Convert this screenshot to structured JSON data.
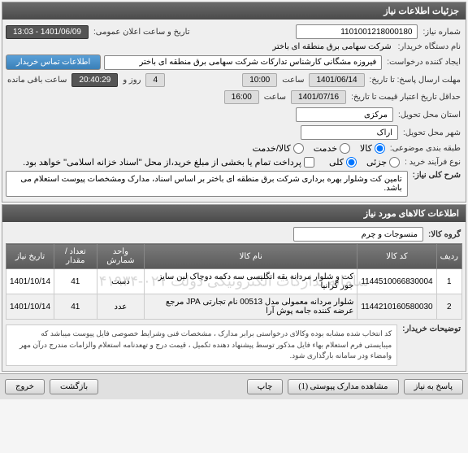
{
  "panel1": {
    "title": "جزئیات اطلاعات نیاز",
    "need_number_label": "شماره نیاز:",
    "need_number": "1101001218000180",
    "announce_label": "تاریخ و ساعت اعلان عمومی:",
    "announce_value": "1401/06/09 - 13:03",
    "buyer_label": "نام دستگاه خریدار:",
    "buyer_value": "شرکت سهامی برق منطقه ای باختر",
    "requester_label": "ایجاد کننده درخواست:",
    "requester_value": "فیروزه مشگانی کارشناس تدارکات شرکت سهامی برق منطقه ای باختر",
    "contact_btn": "اطلاعات تماس خریدار",
    "deadline_label": "مهلت ارسال پاسخ: تا تاریخ:",
    "deadline_date": "1401/06/14",
    "time_label": "ساعت",
    "deadline_time": "10:00",
    "day_label": "روز و",
    "days_value": "4",
    "countdown": "20:40:29",
    "remaining_label": "ساعت باقی مانده",
    "price_valid_label": "حداقل تاریخ اعتبار قیمت تا تاریخ:",
    "price_valid_date": "1401/07/16",
    "price_valid_time": "16:00",
    "province_label": "استان محل تحویل:",
    "province_value": "مرکزی",
    "city_label": "شهر محل تحویل:",
    "city_value": "اراک",
    "classification_label": "طبقه بندی موضوعی:",
    "radio_goods": "کالا",
    "radio_service": "خدمت",
    "radio_both": "کالا/خدمت",
    "process_label": "نوع فرآیند خرید :",
    "radio_partial": "جزئی",
    "radio_full": "کلی",
    "payment_note": "پرداخت تمام یا بخشی از مبلغ خرید،از محل \"اسناد خزانه اسلامی\" خواهد بود.",
    "overall_label": "شرح کلی نیاز:",
    "overall_text": "تامین کت وشلوار بهره برداری شرکت برق منطقه ای باختر بر اساس اسناد، مدارک ومشخصات پیوست استعلام می باشد."
  },
  "panel2": {
    "title": "اطلاعات کالاهای مورد نیاز",
    "group_label": "گروه کالا:",
    "group_value": "منسوجات و چرم",
    "watermark": "سامانه تدارکات الکترونیکی دولت ۰۲۱-۴۱۹۳۴",
    "headers": {
      "row": "ردیف",
      "code": "کد کالا",
      "name": "نام کالا",
      "unit": "واحد شمارش",
      "qty": "تعداد / مقدار",
      "date": "تاریخ نیاز"
    },
    "rows": [
      {
        "idx": "1",
        "code": "1144510066830004",
        "name": "کت و شلوار مردانه یقه انگلیسی سه دکمه دوچاک لین سایز جور گرانیا",
        "unit": "دست",
        "qty": "41",
        "date": "1401/10/14"
      },
      {
        "idx": "2",
        "code": "1144210160580030",
        "name": "شلوار مردانه معمولی مدل 00513 نام تجارتی JPA مرجع عرضه کننده جامه پوش آرا",
        "unit": "عدد",
        "qty": "41",
        "date": "1401/10/14"
      }
    ],
    "explain_label": "توضیحات خریدار:",
    "explain_text": "کد انتخاب شده مشابه بوده وکالای درخواستی برابر مدارک ، مشخصات فنی وشرایط خصوصی فایل پیوست میباشد که میبایستی فرم استعلام بهاء فایل مذکور توسط پیشنهاد دهنده تکمیل ، قیمت درج و تهعدنامه استعلام والزامات  مندرج درآن مهر وامضاء ودر سامانه بارگذاری شود."
  },
  "buttons": {
    "back": "بازگشت",
    "exit": "خروج",
    "print": "چاپ",
    "attachments": "مشاهده مدارک پیوستی (1)",
    "respond": "پاسخ به نیاز"
  }
}
